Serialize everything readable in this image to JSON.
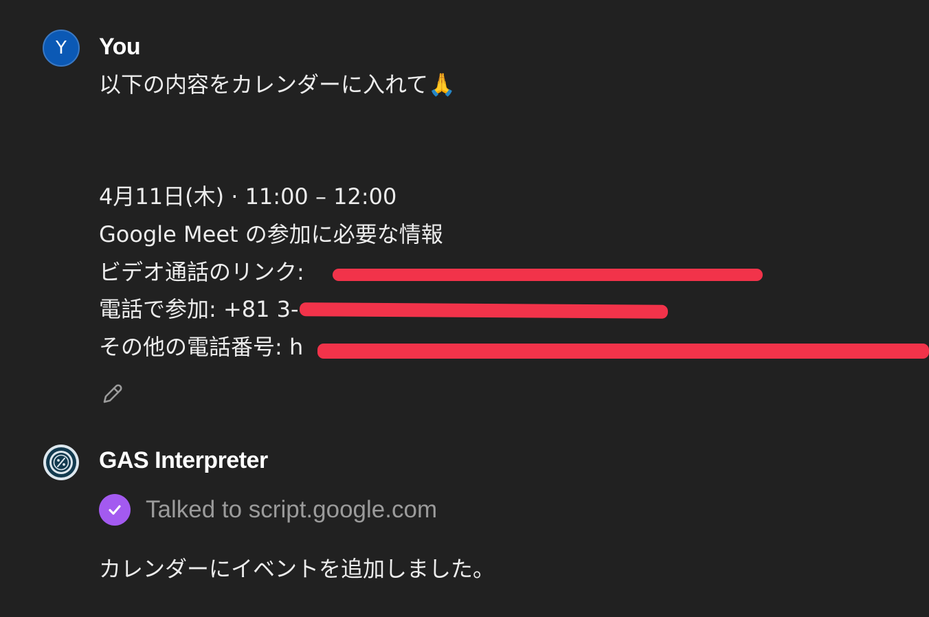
{
  "user": {
    "avatar_initial": "Y",
    "name": "You",
    "avatar_color": "#0b59b5"
  },
  "user_message": {
    "line1": "以下の内容をカレンダーに入れて🙏",
    "line_datetime": "4月11日(木) · 11:00 – 12:00",
    "line_meet_info": "Google Meet の参加に必要な情報",
    "video_link_label": "ビデオ通話のリンク:",
    "phone_label": "電話で参加:",
    "phone_partial": " +81 3-",
    "other_numbers_label": "その他の電話番号:",
    "other_numbers_partial": " h"
  },
  "redaction_color": "#f2334a",
  "edit_icon": "pencil-icon",
  "assistant": {
    "name": "GAS Interpreter",
    "avatar_icon": "gas-interpreter-logo-icon"
  },
  "tool_call": {
    "status_icon": "check-icon",
    "status_color": "#a35af0",
    "text": "Talked to script.google.com"
  },
  "assistant_message": {
    "text": "カレンダーにイベントを追加しました。"
  }
}
